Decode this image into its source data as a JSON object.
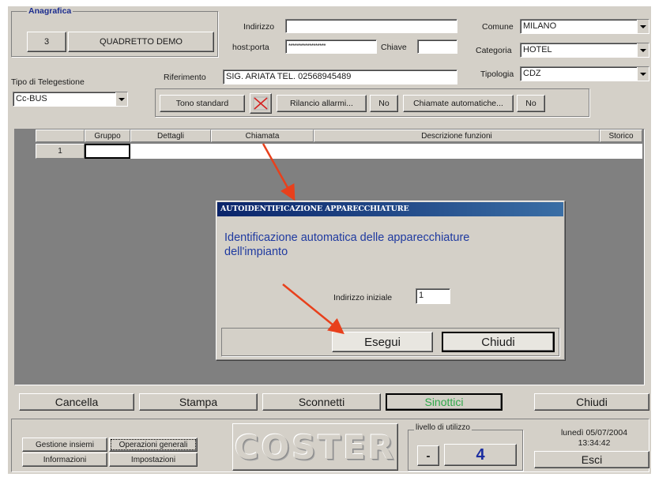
{
  "anagrafica": {
    "title": "Anagrafica",
    "plant_number": "3",
    "plant_name": "QUADRETTO DEMO"
  },
  "address": {
    "indirizzo_label": "Indirizzo",
    "indirizzo_value": "",
    "hostporta_label": "host:porta",
    "hostporta_value": "******************",
    "chiave_label": "Chiave",
    "chiave_value": "",
    "riferimento_label": "Riferimento",
    "riferimento_value": "SIG. ARIATA TEL. 02568945489"
  },
  "location": {
    "comune_label": "Comune",
    "comune_value": "MILANO",
    "categoria_label": "Categoria",
    "categoria_value": "HOTEL",
    "tipologia_label": "Tipologia",
    "tipologia_value": "CDZ"
  },
  "telegestione": {
    "label": "Tipo di Telegestione",
    "value": "Cc-BUS"
  },
  "toolbar": {
    "tono_label": "Tono standard",
    "rilancio_label": "Rilancio allarmi...",
    "rilancio_value": "No",
    "chiamate_label": "Chiamate automatiche...",
    "chiamate_value": "No"
  },
  "table": {
    "columns": [
      "Gruppo",
      "Dettagli",
      "Chiamata",
      "Descrizione funzioni",
      "Storico"
    ],
    "rows": [
      {
        "index": "1"
      }
    ]
  },
  "dialog": {
    "title": "AUTOIDENTIFICAZIONE APPARECCHIATURE",
    "message": "Identificazione automatica delle apparecchiature dell'impianto",
    "start_label": "Indirizzo iniziale",
    "start_value": "1",
    "run_label": "Esegui",
    "close_label": "Chiudi"
  },
  "actions": {
    "cancella": "Cancella",
    "stampa": "Stampa",
    "sconnetti": "Sconnetti",
    "sinottici": "Sinottici",
    "chiudi": "Chiudi"
  },
  "bottom": {
    "gestione_insiemi": "Gestione insiemi",
    "operazioni_generali": "Operazioni generali",
    "informazioni": "Informazioni",
    "impostazioni": "Impostazioni",
    "logo": "COSTER",
    "livello_label": "livello di utilizzo",
    "livello_minus": "-",
    "livello_value": "4",
    "date": "lunedì 05/07/2004",
    "time": "13:34:42",
    "esci": "Esci"
  },
  "colors": {
    "face": "#d4d0c8",
    "title_blue": "#1c2d8f",
    "dialog_text": "#1f3aa0",
    "arrow": "#e8401c",
    "sinottici_green": "#2fa84a",
    "level_blue": "#1a2ca0"
  }
}
